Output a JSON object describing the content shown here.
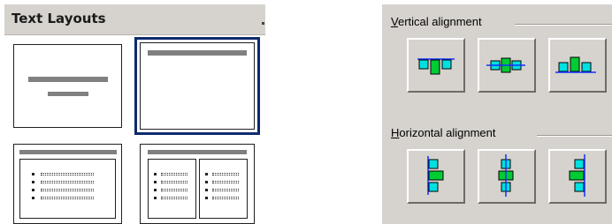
{
  "text_layouts": {
    "title": "Text Layouts",
    "items": [
      {
        "name": "Title Slide"
      },
      {
        "name": "Title Only",
        "selected": true
      },
      {
        "name": "Title and Text"
      },
      {
        "name": "Title and 2-Column Text"
      }
    ]
  },
  "alignment": {
    "vertical": {
      "label_hotkey": "V",
      "label_rest": "ertical alignment",
      "buttons": [
        {
          "name": "Align Top"
        },
        {
          "name": "Align Middle"
        },
        {
          "name": "Align Bottom"
        }
      ]
    },
    "horizontal": {
      "label_hotkey": "H",
      "label_rest": "orizontal alignment",
      "buttons": [
        {
          "name": "Align Left"
        },
        {
          "name": "Align Center"
        },
        {
          "name": "Align Right"
        }
      ]
    }
  },
  "colors": {
    "panel_bg": "#d6d3ce",
    "selection": "#0d2a6e",
    "shape_green": "#00cc33",
    "shape_cyan": "#00e0e0",
    "guide_blue": "#1030ff"
  }
}
